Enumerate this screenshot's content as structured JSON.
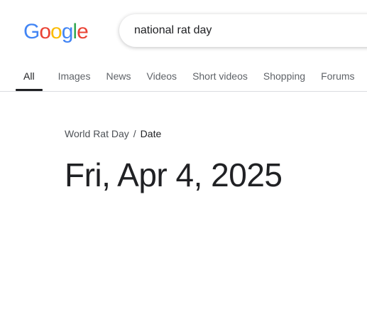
{
  "logo": {
    "letters": [
      "G",
      "o",
      "o",
      "g",
      "l",
      "e"
    ],
    "colors": [
      "#4285f4",
      "#ea4335",
      "#fbbc05",
      "#4285f4",
      "#34a853",
      "#ea4335"
    ]
  },
  "search": {
    "value": "national rat day"
  },
  "tabs": [
    {
      "label": "All",
      "active": true
    },
    {
      "label": "Images",
      "active": false
    },
    {
      "label": "News",
      "active": false
    },
    {
      "label": "Videos",
      "active": false
    },
    {
      "label": "Short videos",
      "active": false
    },
    {
      "label": "Shopping",
      "active": false
    },
    {
      "label": "Forums",
      "active": false
    }
  ],
  "result": {
    "breadcrumb": {
      "parent": "World Rat Day",
      "separator": "/",
      "current": "Date"
    },
    "answer": "Fri, Apr 4, 2025"
  }
}
